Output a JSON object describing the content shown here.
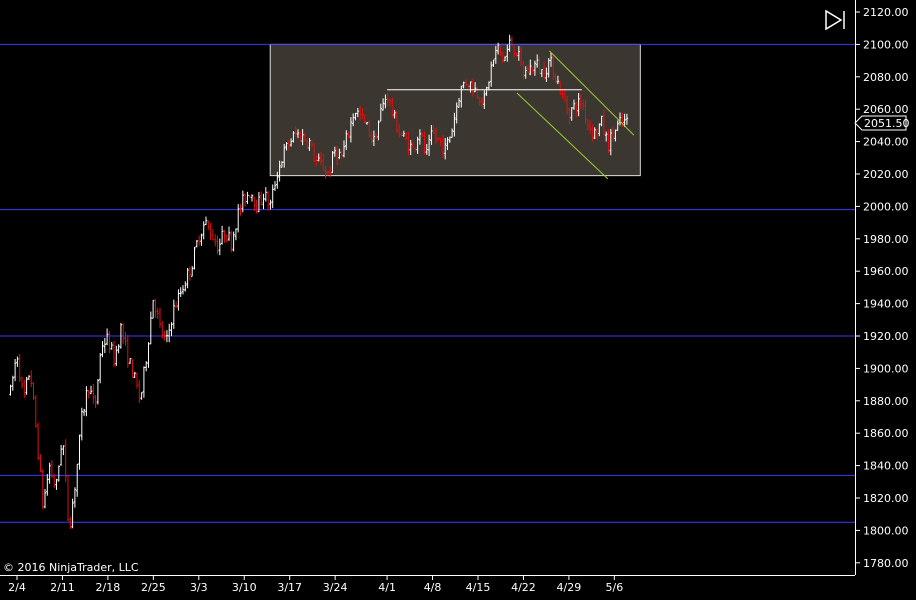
{
  "copyright": "© 2016 NinjaTrader, LLC",
  "current_price_label": "2051.50",
  "icons": {
    "play": "play-to-end-icon"
  },
  "colors": {
    "background": "#000000",
    "up_bar": "#ffffff",
    "down_bar": "#e01010",
    "horizontal_line": "#3a3aff",
    "consolidation_box": "#3b3730",
    "channel": "#9acd32",
    "box_midline": "#ffffff"
  },
  "chart_data": {
    "type": "ohlc",
    "title": "",
    "xlabel": "",
    "ylabel": "",
    "ylim": [
      1770,
      2125
    ],
    "y_ticks": [
      2120,
      2100,
      2080,
      2060,
      2040,
      2020,
      2000,
      1980,
      1960,
      1940,
      1920,
      1900,
      1880,
      1860,
      1840,
      1820,
      1800,
      1780
    ],
    "x_ticks": [
      "2/4",
      "2/11",
      "2/18",
      "2/25",
      "3/3",
      "3/10",
      "3/17",
      "3/24",
      "4/1",
      "4/8",
      "4/15",
      "4/22",
      "4/29",
      "5/6"
    ],
    "last_price": 2051.5,
    "horizontal_lines": [
      2100,
      1998,
      1920,
      1834,
      1805
    ],
    "consolidation_box": {
      "from": "3/14",
      "to": "5/10",
      "high": 2100,
      "low": 2019
    },
    "box_midline": {
      "from": "4/1",
      "to": "5/1",
      "value": 2072
    },
    "channel_lines": [
      {
        "from": {
          "date": "4/26",
          "price": 2096
        },
        "to": {
          "date": "5/9",
          "price": 2044
        }
      },
      {
        "from": {
          "date": "4/21",
          "price": 2070
        },
        "to": {
          "date": "5/5",
          "price": 2017
        }
      }
    ],
    "price_path": [
      [
        "2/3",
        1885
      ],
      [
        "2/4",
        1910
      ],
      [
        "2/5",
        1880
      ],
      [
        "2/6",
        1900
      ],
      [
        "2/7",
        1860
      ],
      [
        "2/8",
        1815
      ],
      [
        "2/9",
        1840
      ],
      [
        "2/10",
        1825
      ],
      [
        "2/11",
        1860
      ],
      [
        "2/12",
        1800
      ],
      [
        "2/13",
        1830
      ],
      [
        "2/14",
        1870
      ],
      [
        "2/15",
        1890
      ],
      [
        "2/16",
        1875
      ],
      [
        "2/17",
        1915
      ],
      [
        "2/18",
        1918
      ],
      [
        "2/19",
        1905
      ],
      [
        "2/20",
        1925
      ],
      [
        "2/21",
        1908
      ],
      [
        "2/22",
        1895
      ],
      [
        "2/23",
        1880
      ],
      [
        "2/24",
        1910
      ],
      [
        "2/25",
        1945
      ],
      [
        "2/26",
        1925
      ],
      [
        "2/27",
        1915
      ],
      [
        "2/28",
        1935
      ],
      [
        "3/1",
        1955
      ],
      [
        "3/2",
        1965
      ],
      [
        "3/3",
        1982
      ],
      [
        "3/4",
        1990
      ],
      [
        "3/5",
        1983
      ],
      [
        "3/6",
        1975
      ],
      [
        "3/7",
        1985
      ],
      [
        "3/8",
        1978
      ],
      [
        "3/9",
        1995
      ],
      [
        "3/10",
        2005
      ],
      [
        "3/11",
        2010
      ],
      [
        "3/12",
        2000
      ],
      [
        "3/13",
        2008
      ],
      [
        "3/14",
        2000
      ],
      [
        "3/15",
        2020
      ],
      [
        "3/16",
        2032
      ],
      [
        "3/17",
        2040
      ],
      [
        "3/18",
        2045
      ],
      [
        "3/19",
        2043
      ],
      [
        "3/20",
        2040
      ],
      [
        "3/21",
        2028
      ],
      [
        "3/22",
        2025
      ],
      [
        "3/23",
        2020
      ],
      [
        "3/24",
        2035
      ],
      [
        "3/25",
        2030
      ],
      [
        "3/26",
        2045
      ],
      [
        "3/27",
        2060
      ],
      [
        "3/28",
        2055
      ],
      [
        "3/29",
        2048
      ],
      [
        "3/30",
        2040
      ],
      [
        "3/31",
        2058
      ],
      [
        "4/1",
        2070
      ],
      [
        "4/2",
        2055
      ],
      [
        "4/3",
        2045
      ],
      [
        "4/4",
        2040
      ],
      [
        "4/5",
        2035
      ],
      [
        "4/6",
        2048
      ],
      [
        "4/7",
        2030
      ],
      [
        "4/8",
        2045
      ],
      [
        "4/9",
        2040
      ],
      [
        "4/10",
        2035
      ],
      [
        "4/11",
        2048
      ],
      [
        "4/12",
        2068
      ],
      [
        "4/13",
        2078
      ],
      [
        "4/14",
        2075
      ],
      [
        "4/15",
        2070
      ],
      [
        "4/16",
        2065
      ],
      [
        "4/17",
        2085
      ],
      [
        "4/18",
        2098
      ],
      [
        "4/19",
        2090
      ],
      [
        "4/20",
        2102
      ],
      [
        "4/21",
        2095
      ],
      [
        "4/22",
        2082
      ],
      [
        "4/23",
        2085
      ],
      [
        "4/24",
        2088
      ],
      [
        "4/25",
        2082
      ],
      [
        "4/26",
        2090
      ],
      [
        "4/27",
        2080
      ],
      [
        "4/28",
        2068
      ],
      [
        "4/29",
        2058
      ],
      [
        "4/30",
        2062
      ],
      [
        "5/1",
        2065
      ],
      [
        "5/2",
        2050
      ],
      [
        "5/3",
        2045
      ],
      [
        "5/4",
        2052
      ],
      [
        "5/5",
        2038
      ],
      [
        "5/6",
        2046
      ],
      [
        "5/7",
        2052
      ],
      [
        "5/8",
        2051.5
      ]
    ]
  }
}
